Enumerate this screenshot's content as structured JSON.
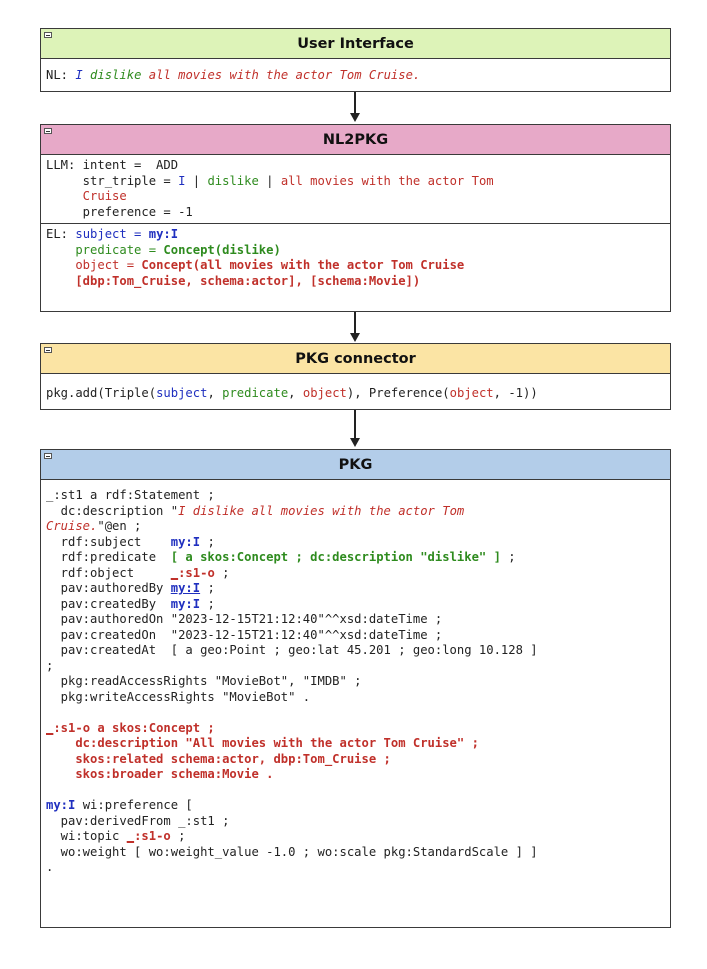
{
  "boxes": {
    "ui": {
      "title": "User Interface",
      "color": "#ddf3b8"
    },
    "nl2pkg": {
      "title": "NL2PKG",
      "color": "#e7a9c8"
    },
    "connector": {
      "title": "PKG connector",
      "color": "#fbe4a4"
    },
    "pkg": {
      "title": "PKG",
      "color": "#b3cde9"
    }
  },
  "ui": {
    "nl_label": "NL: ",
    "nl_text_i": "I",
    "nl_text_dislike": "dislike",
    "nl_text_rest": "all movies with the actor Tom Cruise."
  },
  "llm": {
    "l1": "LLM: intent =  ADD",
    "l2a": "     str_triple = ",
    "l2b": "I",
    "l2c": " | ",
    "l2d": "dislike",
    "l2e": " | ",
    "l2f": "all movies with the actor Tom",
    "l3": "     Cruise",
    "l4": "     preference = -1"
  },
  "el": {
    "l1a": "EL: ",
    "l1b": "subject = ",
    "l1c": "my:I",
    "l2a": "    predicate = ",
    "l2b": "Concept(dislike)",
    "l3a": "    object = ",
    "l3b": "Concept(all movies with the actor Tom Cruise",
    "l4": "    [dbp:Tom_Cruise, schema:actor], [schema:Movie])"
  },
  "conn": {
    "a": "pkg.add(Triple(",
    "b": "subject",
    "c": ", ",
    "d": "predicate",
    "e": ", ",
    "f": "object",
    "g": "), Preference(",
    "h": "object",
    "i": ", -1))"
  },
  "pkg": {
    "p1": "_:st1 a rdf:Statement ;",
    "p2a": "  dc:description \"",
    "p2b": "I dislike all movies with the actor Tom",
    "p3a": "Cruise.",
    "p3b": "\"@en ;",
    "p4a": "  rdf:subject    ",
    "p4b": "my:I",
    "p4c": " ;",
    "p5a": "  rdf:predicate  ",
    "p5b": "[ a skos:Concept ; dc:description \"dislike\" ]",
    "p5c": " ;",
    "p6a": "  rdf:object     ",
    "p6b": "_",
    "p6c": ":s1-o",
    "p6d": " ;",
    "p7a": "  pav:authoredBy ",
    "p7b": "my:I",
    "p7c": " ;",
    "p8a": "  pav:createdBy  ",
    "p8b": "my:I",
    "p8c": " ;",
    "p9": "  pav:authoredOn \"2023-12-15T21:12:40\"^^xsd:dateTime ;",
    "p10": "  pav:createdOn  \"2023-12-15T21:12:40\"^^xsd:dateTime ;",
    "p11": "  pav:createdAt  [ a geo:Point ; geo:lat 45.201 ; geo:long 10.128 ]",
    "p12": ";",
    "p13": "  pkg:readAccessRights \"MovieBot\", \"IMDB\" ;",
    "p14": "  pkg:writeAccessRights \"MovieBot\" .",
    "p15a": "_",
    "p15b": ":s1-o a skos:Concept ;",
    "p16": "    dc:description \"All movies with the actor Tom Cruise\" ;",
    "p17": "    skos:related schema:actor, dbp:Tom_Cruise ;",
    "p18": "    skos:broader schema:Movie .",
    "p19a": "my:I",
    "p19b": " wi:preference [",
    "p20": "  pav:derivedFrom _:st1 ;",
    "p21a": "  wi:topic ",
    "p21b": "_",
    "p21c": ":s1-o",
    "p21d": " ;",
    "p22": "  wo:weight [ wo:weight_value -1.0 ; wo:scale pkg:StandardScale ] ]",
    "p23": "."
  }
}
